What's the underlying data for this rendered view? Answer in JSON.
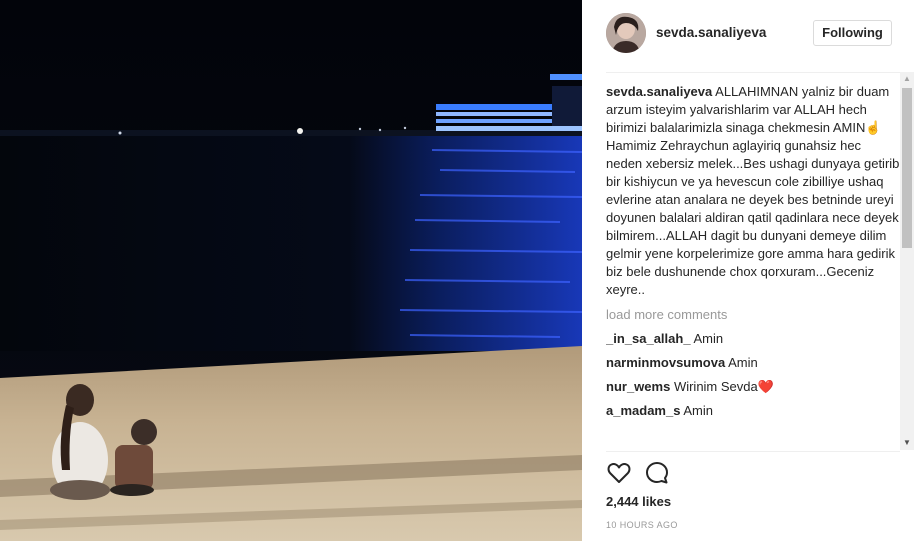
{
  "post": {
    "username": "sevda.sanaliyeva",
    "follow_button": "Following",
    "caption_user": "sevda.sanaliyeva",
    "caption_text": " ALLAHIMNAN yalniz bir duam arzum isteyim yalvarishlarim var ALLAH hech birimizi balalarimizla sinaga chekmesin AMIN☝️Hamimiz Zehraychun aglayiriq gunahsiz hec neden xebersiz melek...Bes ushagi dunyaya getirib bir kishiycun ve ya hevescun cole zibilliye ushaq evlerine atan analara ne deyek bes betninde ureyi doyunen balalari aldiran qatil qadinlara nece deyek bilmirem...ALLAH dagit bu dunyani demeye dilim gelmir yene korpelerimize gore amma hara gedirik biz bele dushunende chox qorxuram...Geceniz xeyre..",
    "load_more": "load more comments",
    "comments": [
      {
        "user": "_in_sa_allah_",
        "text": "Amin"
      },
      {
        "user": "narminmovsumova",
        "text": "Amin"
      },
      {
        "user": "nur_wems",
        "text": "Wirinim Sevda❤️"
      },
      {
        "user": "a_madam_s",
        "text": "Amin"
      }
    ],
    "likes": "2,444 likes",
    "time": "10 HOURS AGO"
  },
  "icons": {
    "like": "heart-outline-icon",
    "comment": "comment-bubble-icon",
    "avatar": "profile-photo"
  },
  "colors": {
    "text": "#262626",
    "muted": "#999999",
    "border": "#dbdbdb"
  }
}
